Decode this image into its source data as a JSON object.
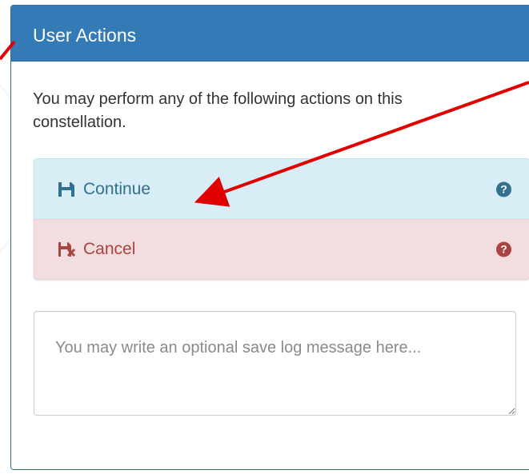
{
  "panel": {
    "title": "User Actions",
    "intro": "You may perform any of the following actions on this constellation."
  },
  "actions": [
    {
      "label": "Continue",
      "icon": "save-icon",
      "help_icon": "question-circle-icon",
      "color": "#31708f",
      "background": "#d9edf7"
    },
    {
      "label": "Cancel",
      "icon": "save-cancel-icon",
      "help_icon": "question-circle-icon",
      "color": "#a94442",
      "background": "#f2dede"
    }
  ],
  "log_message": {
    "value": "",
    "placeholder": "You may write an optional save log message here..."
  },
  "colors": {
    "heading_background": "#337ab7",
    "annotation_arrow": "#e00000"
  }
}
